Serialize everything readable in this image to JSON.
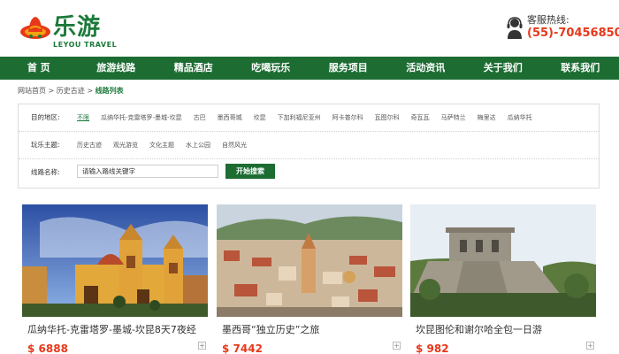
{
  "header": {
    "logo_cn": "乐游",
    "logo_en": "LEYOU TRAVEL",
    "hotline_label": "客服热线:",
    "hotline_number": "(55)-70456850"
  },
  "nav": {
    "items": [
      "首 页",
      "旅游线路",
      "精品酒店",
      "吃喝玩乐",
      "服务项目",
      "活动资讯",
      "关于我们",
      "联系我们"
    ]
  },
  "breadcrumb": {
    "home": "网站首页",
    "sep": ">",
    "parent": "历史古迹",
    "current": "线路列表"
  },
  "filter": {
    "destination_label": "目的地区:",
    "destinations": [
      "不限",
      "瓜纳华托-克雷塔罗-墨城-坎昆",
      "古巴",
      "墨西哥城",
      "坎昆",
      "下加利福尼亚州",
      "阿卡普尔科",
      "瓦图尔科",
      "奇瓦瓦",
      "马萨特兰",
      "梅里达",
      "瓜纳华托"
    ],
    "active_destination": 0,
    "theme_label": "玩乐主题:",
    "themes": [
      "历史古迹",
      "观光游览",
      "文化主题",
      "水上公园",
      "自然风光"
    ],
    "route_label": "线路名称:",
    "search_placeholder": "请输入路线关键字",
    "search_button": "开始搜索"
  },
  "cards": [
    {
      "title": "瓜纳华托-克雷塔罗-墨城-坎昆8天7夜经",
      "price": "$ 6888",
      "plus": "+"
    },
    {
      "title": "墨西哥“独立历史”之旅",
      "price": "$ 7442",
      "plus": "+"
    },
    {
      "title": "坎昆图伦和谢尔哈全包一日游",
      "price": "$ 982",
      "plus": "+"
    }
  ],
  "colors": {
    "brand_green": "#1d6d33",
    "price_red": "#e8381a"
  }
}
